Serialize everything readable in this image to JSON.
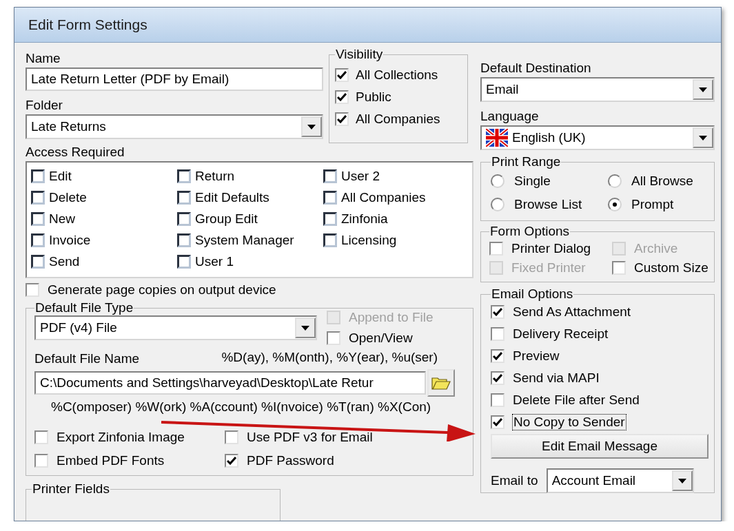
{
  "window": {
    "title": "Edit Form Settings"
  },
  "name": {
    "label": "Name",
    "value": "Late Return Letter (PDF by Email)"
  },
  "folder": {
    "label": "Folder",
    "value": "Late Returns"
  },
  "visibility": {
    "title": "Visibility",
    "options": [
      {
        "label": "All Collections",
        "checked": true
      },
      {
        "label": "Public",
        "checked": true
      },
      {
        "label": "All Companies",
        "checked": true
      }
    ]
  },
  "access": {
    "label": "Access Required",
    "columns": [
      [
        {
          "label": "Edit",
          "checked": false
        },
        {
          "label": "Delete",
          "checked": false
        },
        {
          "label": "New",
          "checked": false
        },
        {
          "label": "Invoice",
          "checked": false
        },
        {
          "label": "Send",
          "checked": false
        }
      ],
      [
        {
          "label": "Return",
          "checked": false
        },
        {
          "label": "Edit Defaults",
          "checked": false
        },
        {
          "label": "Group Edit",
          "checked": false
        },
        {
          "label": "System Manager",
          "checked": false
        },
        {
          "label": "User 1",
          "checked": false
        }
      ],
      [
        {
          "label": "User 2",
          "checked": false
        },
        {
          "label": "All Companies",
          "checked": false
        },
        {
          "label": "Zinfonia",
          "checked": false
        },
        {
          "label": "Licensing",
          "checked": false
        }
      ]
    ]
  },
  "page_copies": {
    "label": "Generate page copies on output device",
    "checked": false
  },
  "file_type": {
    "title": "Default File Type",
    "value": "PDF (v4) File",
    "side_options": [
      {
        "label": "Append to File",
        "checked": false,
        "disabled": true
      },
      {
        "label": "Open/View",
        "checked": false,
        "disabled": false
      }
    ],
    "file_name_label": "Default File Name",
    "tokens_top": "%D(ay), %M(onth), %Y(ear), %u(ser)",
    "file_name": "C:\\Documents and Settings\\harveyad\\Desktop\\Late Retur",
    "tokens_bottom": "%C(omposer) %W(ork) %A(ccount) %I(nvoice) %T(ran) %X(Con)",
    "options": [
      {
        "label": "Export Zinfonia Image",
        "checked": false,
        "disabled": false
      },
      {
        "label": "Use PDF v3 for Email",
        "checked": false,
        "disabled": false
      },
      {
        "label": "Embed PDF Fonts",
        "checked": false,
        "disabled": false
      },
      {
        "label": "PDF Password",
        "checked": true,
        "disabled": false
      }
    ]
  },
  "printer_fields": {
    "title": "Printer Fields"
  },
  "default_destination": {
    "label": "Default Destination",
    "value": "Email"
  },
  "language": {
    "label": "Language",
    "value": "English (UK)"
  },
  "print_range": {
    "title": "Print Range",
    "options": [
      {
        "label": "Single",
        "selected": false
      },
      {
        "label": "All Browse",
        "selected": false
      },
      {
        "label": "Browse List",
        "selected": false
      },
      {
        "label": "Prompt",
        "selected": true
      }
    ]
  },
  "form_options": {
    "title": "Form Options",
    "options": [
      {
        "label": "Printer Dialog",
        "checked": false,
        "disabled": false
      },
      {
        "label": "Archive",
        "checked": false,
        "disabled": true
      },
      {
        "label": "Fixed Printer",
        "checked": false,
        "disabled": true
      },
      {
        "label": "Custom Size",
        "checked": false,
        "disabled": false
      }
    ]
  },
  "email_options": {
    "title": "Email Options",
    "options": [
      {
        "label": "Send As Attachment",
        "checked": true,
        "focused": false
      },
      {
        "label": "Delivery Receipt",
        "checked": false,
        "focused": false
      },
      {
        "label": "Preview",
        "checked": true,
        "focused": false
      },
      {
        "label": "Send via MAPI",
        "checked": true,
        "focused": false
      },
      {
        "label": "Delete File after Send",
        "checked": false,
        "focused": false
      },
      {
        "label": "No Copy to Sender",
        "checked": true,
        "focused": true
      }
    ],
    "button": "Edit Email Message",
    "email_to": {
      "label": "Email to",
      "value": "Account Email"
    }
  }
}
